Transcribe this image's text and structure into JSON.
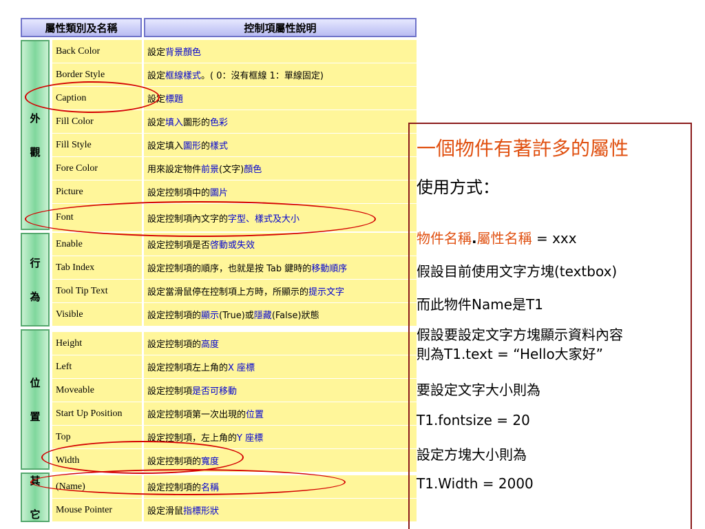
{
  "table": {
    "header_left": "屬性類別及名稱",
    "header_right": "控制項屬性說明",
    "categories": {
      "appearance": "外觀",
      "behavior": "行為",
      "position": "位置",
      "other": "其它"
    },
    "rows": [
      {
        "name": "Back Color",
        "desc_plain": "設定",
        "desc_blue": "背景顏色",
        "desc_tail": ""
      },
      {
        "name": "Border Style",
        "desc_plain": "設定",
        "desc_blue": "框線樣式",
        "desc_tail": "。( 0：沒有框線 1：單線固定)"
      },
      {
        "name": "Caption",
        "desc_plain": "設定",
        "desc_blue": "標題",
        "desc_tail": ""
      },
      {
        "name": "Fill Color",
        "desc_plain": "設定",
        "desc_blue": "填入",
        "desc_tail": "圖形的",
        "desc_blue2": "色彩"
      },
      {
        "name": "Fill Style",
        "desc_plain": "設定填入",
        "desc_blue": "圖形",
        "desc_tail": "的",
        "desc_blue2": "樣式"
      },
      {
        "name": "Fore Color",
        "desc_plain": "用來設定物件",
        "desc_blue": "前景",
        "desc_tail": "(文字)",
        "desc_blue2": "顏色"
      },
      {
        "name": "Picture",
        "desc_plain": "設定控制項中的",
        "desc_blue": "圖片",
        "desc_tail": ""
      },
      {
        "name": "Font",
        "desc_plain": "設定控制項內文字的",
        "desc_blue": "字型、樣式及大小",
        "desc_tail": ""
      },
      {
        "name": "Enable",
        "desc_plain": "設定控制項是否",
        "desc_blue": "啓動或失效",
        "desc_tail": ""
      },
      {
        "name": "Tab Index",
        "desc_plain": "設定控制項的順序，也就是按 Tab 鍵時的",
        "desc_blue": "移動順序",
        "desc_tail": ""
      },
      {
        "name": "Tool Tip Text",
        "desc_plain": "設定當滑鼠停在控制項上方時，所顯示的",
        "desc_blue": "提示文字",
        "desc_tail": ""
      },
      {
        "name": "Visible",
        "desc_plain": "設定控制項的",
        "desc_blue": "顯示",
        "desc_tail": "(True)或",
        "desc_blue2": "隱藏",
        "desc_tail2": "(False)狀態"
      },
      {
        "name": "Height",
        "desc_plain": "設定控制項的",
        "desc_blue": "高度",
        "desc_tail": ""
      },
      {
        "name": "Left",
        "desc_plain": "設定控制項左上角的",
        "desc_blue": " X 座標",
        "desc_tail": ""
      },
      {
        "name": "Moveable",
        "desc_plain": "設定控制項",
        "desc_blue": "是否可移動",
        "desc_tail": ""
      },
      {
        "name": "Start Up Position",
        "desc_plain": "設定控制項第一次出現的",
        "desc_blue": "位置",
        "desc_tail": ""
      },
      {
        "name": "Top",
        "desc_plain": "設定控制項，左上角的",
        "desc_blue": " Y 座標",
        "desc_tail": ""
      },
      {
        "name": "Width",
        "desc_plain": "設定控制項的",
        "desc_blue": "寬度",
        "desc_tail": ""
      },
      {
        "name": "(Name)",
        "desc_plain": "設定控制項的",
        "desc_blue": "名稱",
        "desc_tail": ""
      },
      {
        "name": "Mouse Pointer",
        "desc_plain": "設定滑鼠",
        "desc_blue": "指標形狀",
        "desc_tail": ""
      }
    ]
  },
  "panel": {
    "title": "一個物件有著許多的屬性",
    "usage": "使用方式：",
    "syntax_obj": "物件名稱",
    "syntax_dot": ".",
    "syntax_prop": "屬性名稱",
    "syntax_val": " = xxx",
    "line1": "假設目前使用文字方塊(textbox)",
    "line2": "而此物件Name是T1",
    "line3a": "假設要設定文字方塊顯示資料內容",
    "line3b": "則為T1.text = “Hello大家好”",
    "line4": "要設定文字大小則為",
    "line5": "T1.fontsize = 20",
    "line6": "設定方塊大小則為",
    "line7": "T1.Width = 2000"
  },
  "colors": {
    "accent_red": "#e05010",
    "highlight_circle": "#d40000",
    "link_blue": "#0000d0",
    "cell_yellow": "#fff69a"
  }
}
